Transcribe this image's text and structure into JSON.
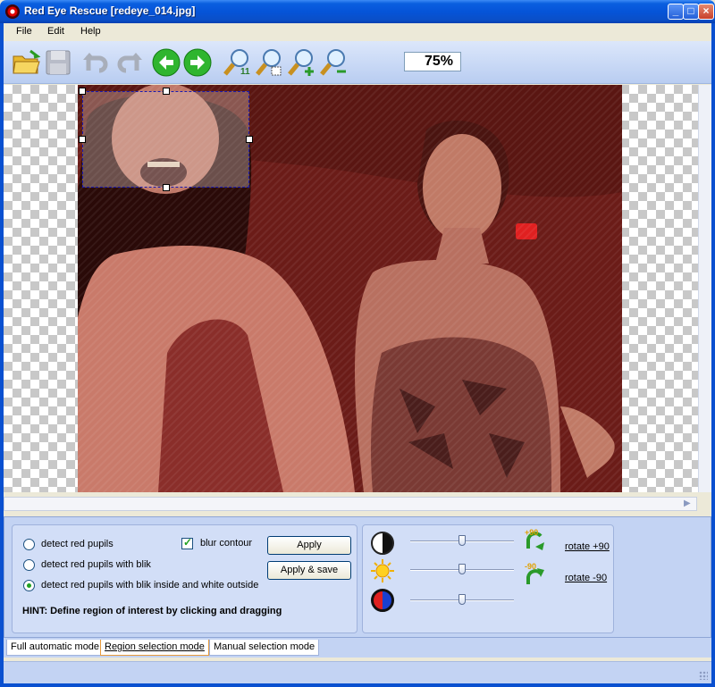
{
  "window": {
    "title": "Red Eye Rescue [redeye_014.jpg]",
    "controls": [
      "minimize",
      "maximize",
      "close"
    ]
  },
  "menu": {
    "items": [
      "File",
      "Edit",
      "Help"
    ]
  },
  "toolbar": {
    "buttons": [
      {
        "name": "open-folder-icon"
      },
      {
        "name": "save-icon"
      },
      {
        "name": "undo-icon"
      },
      {
        "name": "redo-icon"
      },
      {
        "name": "previous-image-icon"
      },
      {
        "name": "next-image-icon"
      },
      {
        "name": "zoom-1-1-icon"
      },
      {
        "name": "zoom-fit-icon"
      },
      {
        "name": "zoom-in-icon"
      },
      {
        "name": "zoom-out-icon"
      }
    ],
    "zoom_value": "75%"
  },
  "options": {
    "radios": [
      {
        "label": "detect red pupils",
        "checked": false
      },
      {
        "label": "detect red pupils with blik",
        "checked": false
      },
      {
        "label": "detect red pupils with blik inside and white outside",
        "checked": true
      }
    ],
    "blur_contour": {
      "label": "blur contour",
      "checked": true
    },
    "apply_label": "Apply",
    "apply_save_label": "Apply & save",
    "hint": "HINT: Define region of interest by clicking and dragging"
  },
  "adjustments": {
    "contrast_level": 0.5,
    "brightness_level": 0.5,
    "color_level": 0.5,
    "rotate_plus_badge": "+90",
    "rotate_minus_badge": "-90",
    "rotate_plus_label": "rotate +90",
    "rotate_minus_label": "rotate -90"
  },
  "tabs": [
    {
      "label": "Full automatic mode",
      "active": false
    },
    {
      "label": "Region selection mode",
      "active": true
    },
    {
      "label": "Manual selection mode",
      "active": false
    }
  ],
  "colors": {
    "accent": "#0554d8",
    "panel": "#c3d3f3",
    "photo_tint": "#6a1a16",
    "selection_border": "#1a1ab0"
  }
}
